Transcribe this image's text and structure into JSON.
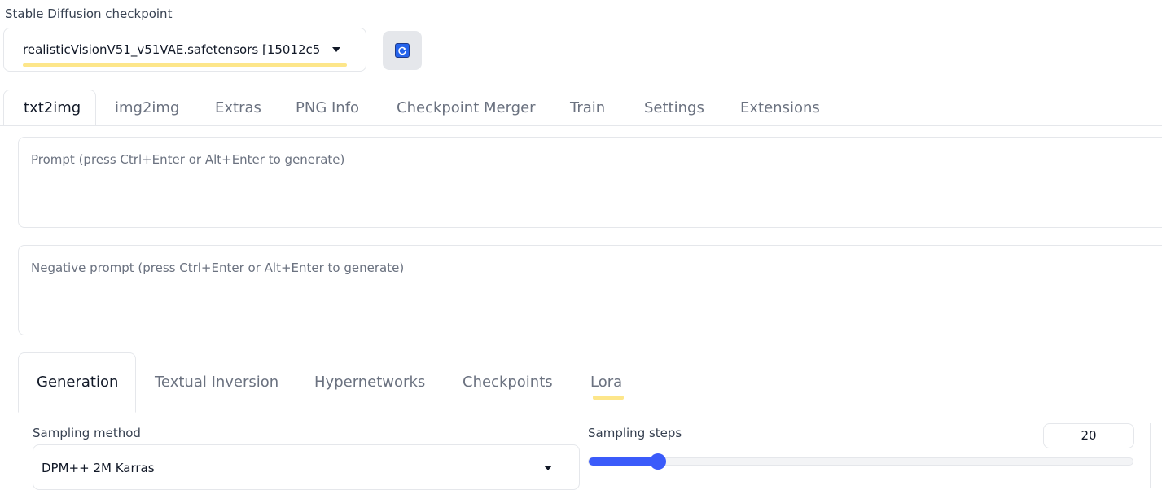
{
  "checkpoint": {
    "label": "Stable Diffusion checkpoint",
    "value": "realisticVisionV51_v51VAE.safetensors [15012c5",
    "refresh_icon": "refresh-icon"
  },
  "top_tabs": [
    {
      "label": "txt2img",
      "active": true
    },
    {
      "label": "img2img"
    },
    {
      "label": "Extras"
    },
    {
      "label": "PNG Info"
    },
    {
      "label": "Checkpoint Merger"
    },
    {
      "label": "Train"
    },
    {
      "label": "Settings"
    },
    {
      "label": "Extensions"
    }
  ],
  "prompt": {
    "placeholder": "Prompt (press Ctrl+Enter or Alt+Enter to generate)"
  },
  "negative_prompt": {
    "placeholder": "Negative prompt (press Ctrl+Enter or Alt+Enter to generate)"
  },
  "sub_tabs": [
    {
      "label": "Generation",
      "active": true
    },
    {
      "label": "Textual Inversion"
    },
    {
      "label": "Hypernetworks"
    },
    {
      "label": "Checkpoints"
    },
    {
      "label": "Lora"
    }
  ],
  "sampling": {
    "method_label": "Sampling method",
    "method_value": "DPM++ 2M Karras",
    "steps_label": "Sampling steps",
    "steps_value": "20",
    "steps_min": 1,
    "steps_max": 150
  },
  "colors": {
    "accent": "#3b5bfa",
    "highlight": "#fde68a"
  }
}
